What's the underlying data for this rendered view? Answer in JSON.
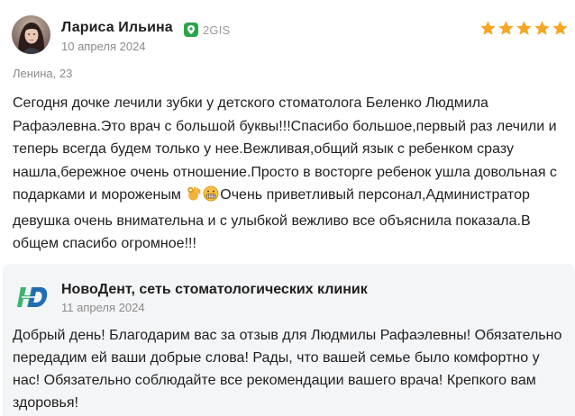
{
  "review": {
    "author": "Лариса Ильина",
    "source": "2GIS",
    "source_icon": "2gis-icon",
    "date": "10 апреля 2024",
    "rating": 5,
    "star_color": "#f5a623",
    "address": "Ленина, 23",
    "text_part1": "Сегодня дочке лечили зубки у детского стоматолога Беленко Людмила Рафаэлевна.Это врач с большой буквы!!!Спасибо большое,первый раз лечили и теперь всегда будем только у нее.Вежливая,общий язык с ребенком сразу нашла,бережное очень отношение.Просто в восторге ребенок ушла довольная с подарками и мороженым",
    "text_part2": "Очень приветливый персонал,Администратор девушка очень внимательна и с улыбкой вежливо все объяснила показала.В общем спасибо огромное!!!",
    "emojis": [
      "ok-hand-icon",
      "grimacing-face-icon"
    ]
  },
  "reply": {
    "company": "НовоДент, сеть стоматологических клиник",
    "logo": "novodent-logo",
    "date": "11 апреля 2024",
    "text": "Добрый день! Благодарим вас за отзыв для Людмилы Рафаэлевны! Обязательно передадим ей ваши добрые слова! Рады, что вашей семье было комфортно у нас! Обязательно соблюдайте все рекомендации вашего врача! Крепкого вам здоровья!"
  },
  "colors": {
    "accent_green": "#2aa64a",
    "logo_blue": "#1f6fb5",
    "logo_green": "#3cb371",
    "reply_bg": "#f4f5f7"
  }
}
